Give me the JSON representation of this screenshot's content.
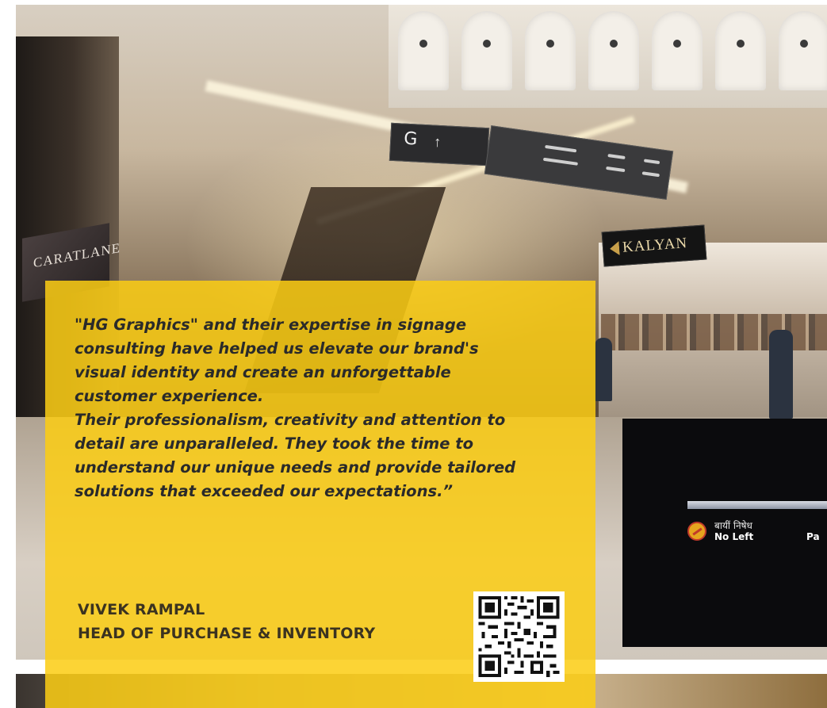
{
  "background_scene": {
    "left_store_sign": "CARATLANE",
    "hanging_sign_level": "G",
    "hanging_sign_arrow": "↑",
    "store_sign": "KALYAN",
    "traffic_sign_hindi": "बायीं निषेध",
    "traffic_sign_english": "No Left",
    "traffic_sign_cut_text": "Pa"
  },
  "testimonial": {
    "quote_part1": "\"HG Graphics\" and their expertise in signage\nconsulting have helped us elevate our brand's\nvisual identity and create an unforgettable\ncustomer experience.",
    "quote_part2": "Their professionalism, creativity and attention to\ndetail are unparalleled. They took the time to\nunderstand our unique needs and provide tailored\nsolutions that exceeded our expectations.”",
    "author_name": "VIVEK RAMPAL",
    "author_title": "HEAD OF PURCHASE & INVENTORY"
  },
  "colors": {
    "panel_yellow": "#fbcd14",
    "text_dark": "#2a2a2a"
  },
  "qr_code": {
    "icon": "qr-code-icon"
  }
}
